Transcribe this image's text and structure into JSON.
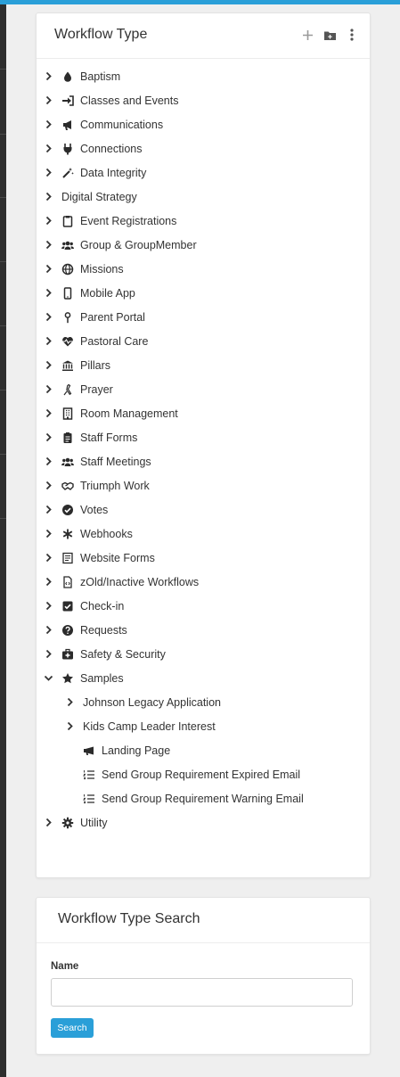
{
  "tree_panel": {
    "title": "Workflow Type",
    "actions": [
      {
        "name": "add-icon"
      },
      {
        "name": "add-folder-icon"
      },
      {
        "name": "more-options-icon"
      }
    ],
    "items": [
      {
        "label": "Baptism",
        "icon": "droplet-icon",
        "expanded": false,
        "level": 0,
        "has_children": true
      },
      {
        "label": "Classes and Events",
        "icon": "sign-in-icon",
        "expanded": false,
        "level": 0,
        "has_children": true
      },
      {
        "label": "Communications",
        "icon": "bullhorn-icon",
        "expanded": false,
        "level": 0,
        "has_children": true
      },
      {
        "label": "Connections",
        "icon": "plug-icon",
        "expanded": false,
        "level": 0,
        "has_children": true
      },
      {
        "label": "Data Integrity",
        "icon": "magic-wand-icon",
        "expanded": false,
        "level": 0,
        "has_children": true
      },
      {
        "label": "Digital Strategy",
        "icon": "",
        "expanded": false,
        "level": 0,
        "has_children": true
      },
      {
        "label": "Event Registrations",
        "icon": "clipboard-icon",
        "expanded": false,
        "level": 0,
        "has_children": true
      },
      {
        "label": "Group & GroupMember",
        "icon": "users-icon",
        "expanded": false,
        "level": 0,
        "has_children": true
      },
      {
        "label": "Missions",
        "icon": "globe-icon",
        "expanded": false,
        "level": 0,
        "has_children": true
      },
      {
        "label": "Mobile App",
        "icon": "mobile-icon",
        "expanded": false,
        "level": 0,
        "has_children": true
      },
      {
        "label": "Parent Portal",
        "icon": "map-pin-icon",
        "expanded": false,
        "level": 0,
        "has_children": true
      },
      {
        "label": "Pastoral Care",
        "icon": "heartbeat-icon",
        "expanded": false,
        "level": 0,
        "has_children": true
      },
      {
        "label": "Pillars",
        "icon": "university-icon",
        "expanded": false,
        "level": 0,
        "has_children": true
      },
      {
        "label": "Prayer",
        "icon": "praying-hands-icon",
        "expanded": false,
        "level": 0,
        "has_children": true
      },
      {
        "label": "Room Management",
        "icon": "building-icon",
        "expanded": false,
        "level": 0,
        "has_children": true
      },
      {
        "label": "Staff Forms",
        "icon": "clipboard-list-icon",
        "expanded": false,
        "level": 0,
        "has_children": true
      },
      {
        "label": "Staff Meetings",
        "icon": "users-icon",
        "expanded": false,
        "level": 0,
        "has_children": true
      },
      {
        "label": "Triumph Work",
        "icon": "handshake-icon",
        "expanded": false,
        "level": 0,
        "has_children": true
      },
      {
        "label": "Votes",
        "icon": "check-circle-icon",
        "expanded": false,
        "level": 0,
        "has_children": true
      },
      {
        "label": "Webhooks",
        "icon": "asterisk-icon",
        "expanded": false,
        "level": 0,
        "has_children": true
      },
      {
        "label": "Website Forms",
        "icon": "form-icon",
        "expanded": false,
        "level": 0,
        "has_children": true
      },
      {
        "label": "zOld/Inactive Workflows",
        "icon": "file-code-icon",
        "expanded": false,
        "level": 0,
        "has_children": true
      },
      {
        "label": "Check-in",
        "icon": "check-square-icon",
        "expanded": false,
        "level": 0,
        "has_children": true
      },
      {
        "label": "Requests",
        "icon": "question-circle-icon",
        "expanded": false,
        "level": 0,
        "has_children": true
      },
      {
        "label": "Safety & Security",
        "icon": "medkit-icon",
        "expanded": false,
        "level": 0,
        "has_children": true
      },
      {
        "label": "Samples",
        "icon": "star-icon",
        "expanded": true,
        "level": 0,
        "has_children": true
      },
      {
        "label": "Johnson Legacy Application",
        "icon": "",
        "expanded": false,
        "level": 1,
        "has_children": true
      },
      {
        "label": "Kids Camp Leader Interest",
        "icon": "",
        "expanded": false,
        "level": 1,
        "has_children": true
      },
      {
        "label": "Landing Page",
        "icon": "bullhorn-side-icon",
        "expanded": false,
        "level": 1,
        "has_children": false
      },
      {
        "label": "Send Group Requirement Expired Email",
        "icon": "list-ol-icon",
        "expanded": false,
        "level": 1,
        "has_children": false
      },
      {
        "label": "Send Group Requirement Warning Email",
        "icon": "list-ol-icon",
        "expanded": false,
        "level": 1,
        "has_children": false
      },
      {
        "label": "Utility",
        "icon": "gear-icon",
        "expanded": false,
        "level": 0,
        "has_children": true
      }
    ]
  },
  "search_panel": {
    "title": "Workflow Type Search",
    "name_label": "Name",
    "name_value": "",
    "name_placeholder": "",
    "search_button": "Search"
  },
  "colors": {
    "accent": "#2a9fd8",
    "sidebar": "#2e2e2e",
    "background": "#efefef"
  }
}
